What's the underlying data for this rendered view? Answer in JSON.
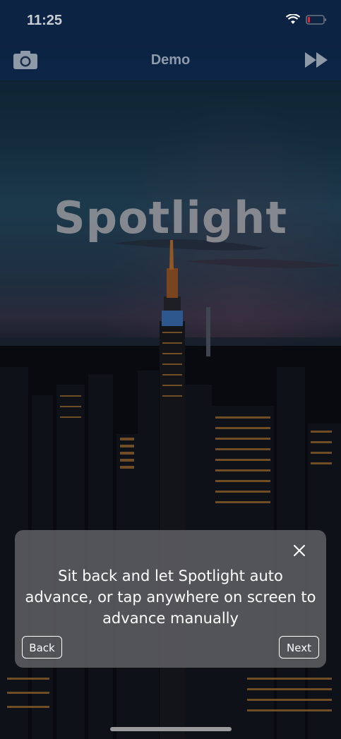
{
  "status_bar": {
    "time": "11:25",
    "wifi_icon": "wifi-icon",
    "battery_icon": "battery-low-icon",
    "battery_color": "#e0283a"
  },
  "nav_bar": {
    "title": "Demo",
    "left_icon": "camera-icon",
    "right_icon": "fast-forward-icon",
    "background": "#0c2448"
  },
  "content": {
    "headline": "Spotlight"
  },
  "spotlight_card": {
    "message": "Sit back and let Spotlight auto advance, or tap anywhere on screen to advance manually",
    "back_label": "Back",
    "next_label": "Next",
    "close_icon": "close-icon"
  }
}
